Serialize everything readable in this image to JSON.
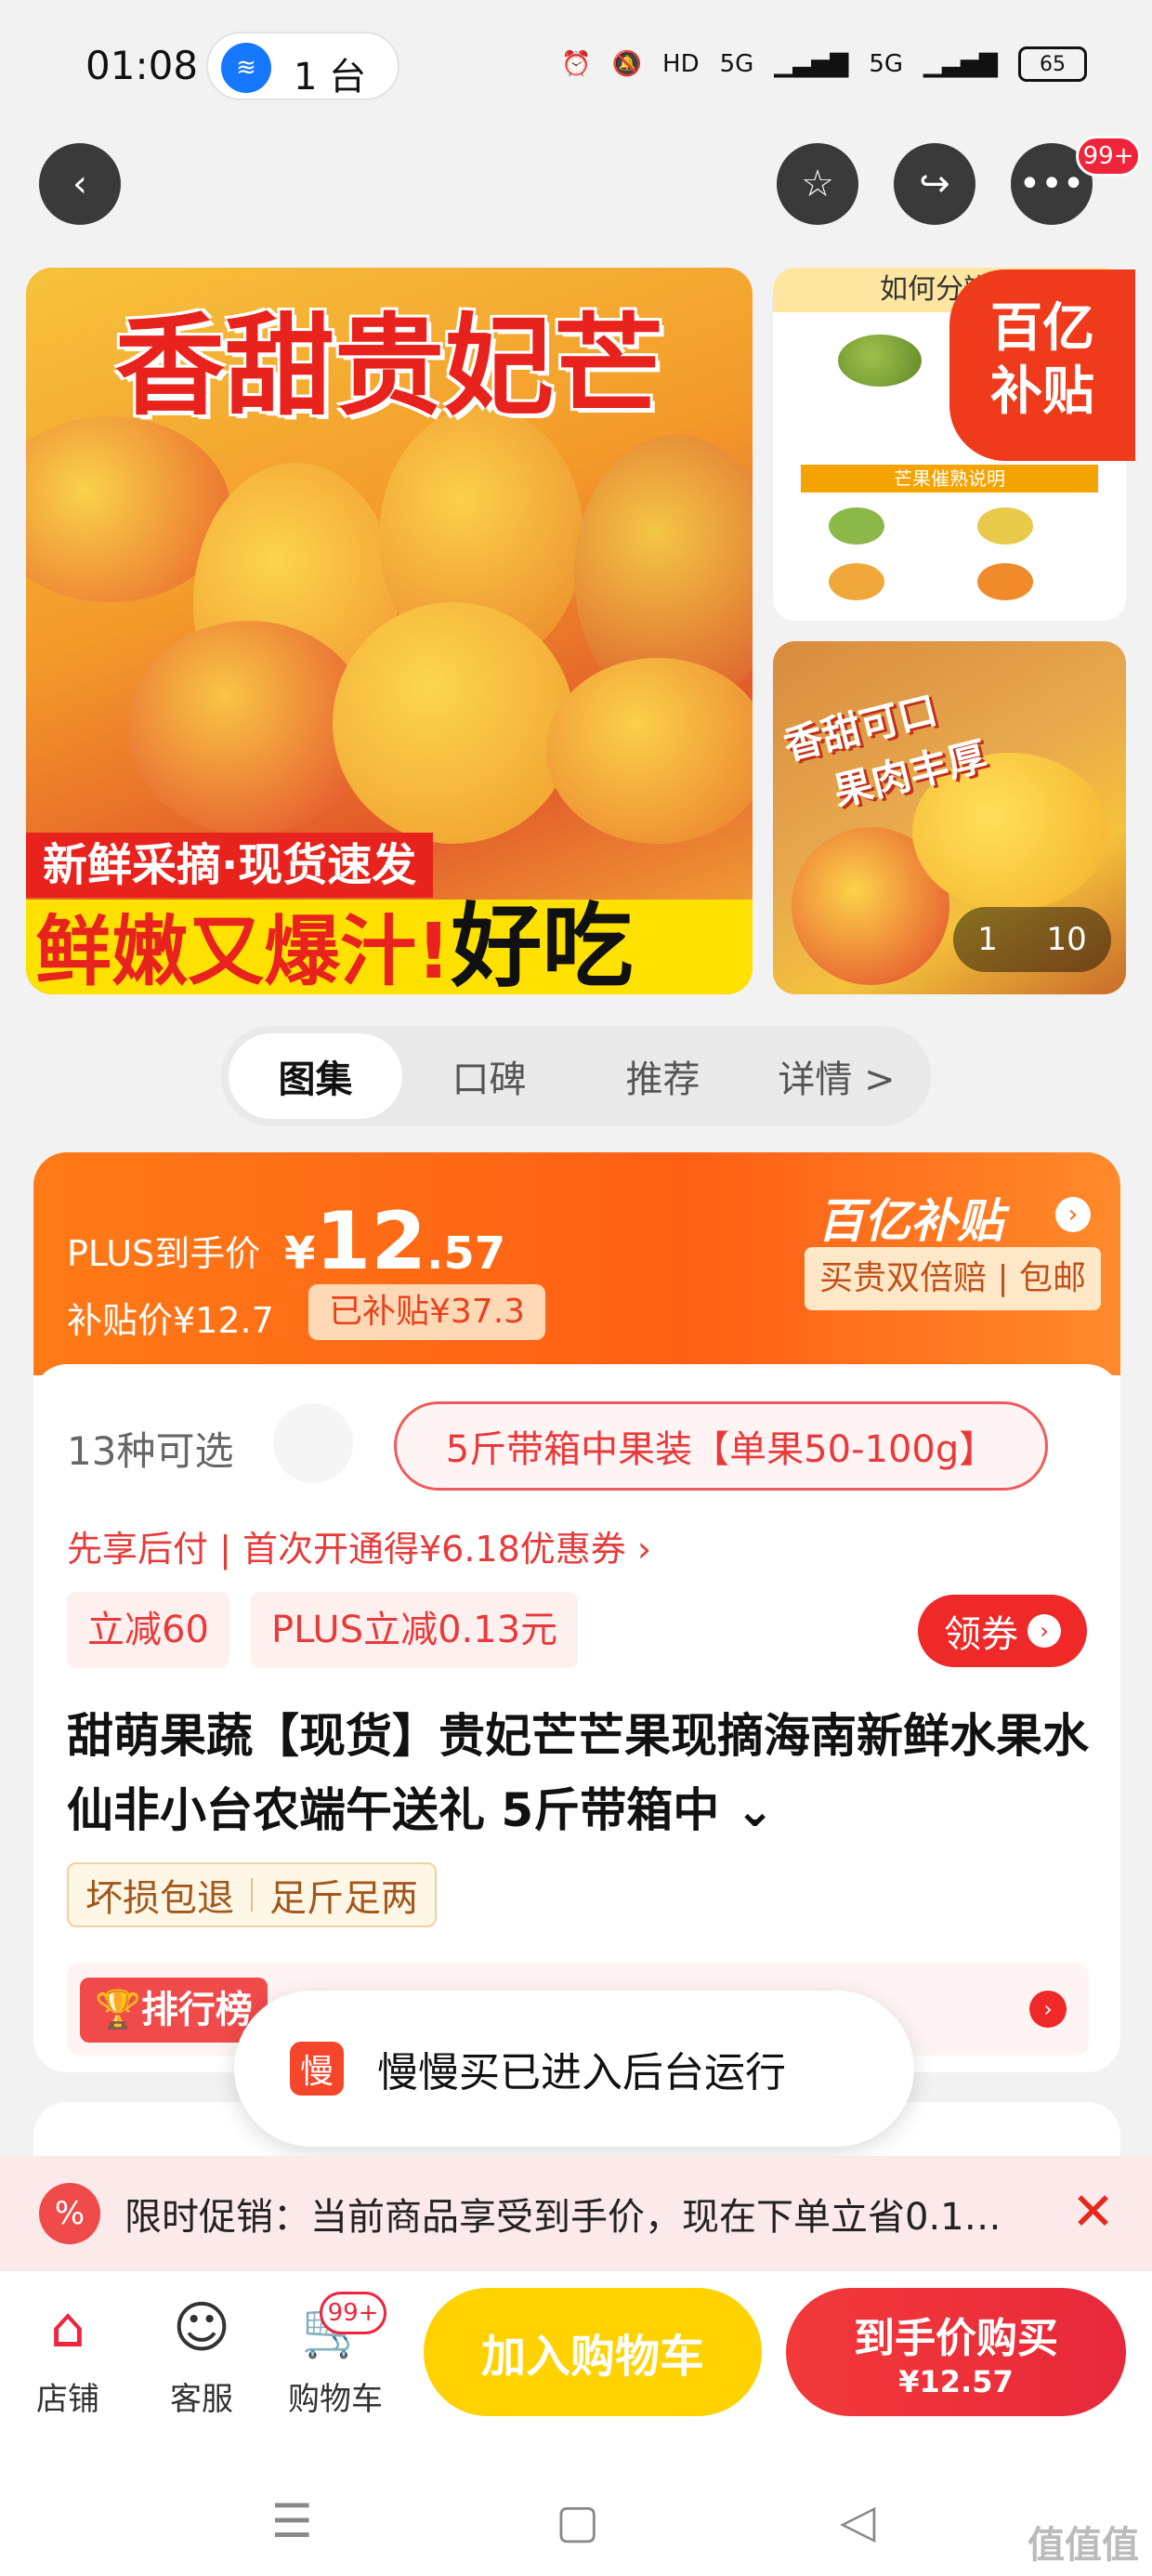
{
  "status_bar": {
    "time": "01:08",
    "hotspot_label": "1 台",
    "battery": "65",
    "signal_labels": [
      "HD",
      "5G",
      "5G"
    ]
  },
  "top_nav": {
    "more_badge": "99+"
  },
  "gallery": {
    "main_title": "香甜贵妃芒",
    "band1": "新鲜采摘·现货速发",
    "band2_red": "鲜嫩又爆汁!",
    "band2_black": "好吃",
    "side1_head": "如何分辨生",
    "side1_bar": "芒果催熟说明",
    "subsidy_tag_1": "百亿",
    "subsidy_tag_2": "补贴",
    "side2_text_1": "香甜可口",
    "side2_text_2": "果肉丰厚",
    "counter_current": "1",
    "counter_total": "10"
  },
  "tabs": [
    {
      "label": "图集"
    },
    {
      "label": "口碑"
    },
    {
      "label": "推荐"
    },
    {
      "label": "详情 >"
    }
  ],
  "price": {
    "plus_label": "PLUS到手价",
    "currency": "¥",
    "int_part": "12",
    "dec_part": ".57",
    "subsidy_label": "补贴价¥12.7",
    "subsidy_chip": "已补贴¥37.3",
    "brand": "百亿补贴",
    "guarantee": "买贵双倍赔 | 包邮"
  },
  "options": {
    "count_label": "13种可选",
    "selected": "5斤带箱中果装【单果50-100g】"
  },
  "pay_line": "先享后付 | 首次开通得¥6.18优惠券 ›",
  "coupons": [
    "立减60",
    "PLUS立减0.13元"
  ],
  "coupon_button": "领券",
  "product_title": "甜萌果蔬【现货】贵妃芒芒果现摘海南新鲜水果水仙非小台农端午送礼 5斤带箱中 ⌄",
  "features": [
    "坏损包退",
    "足斤足两"
  ],
  "rank_tag": "排行榜",
  "toast": {
    "icon": "慢",
    "text": "慢慢买已进入后台运行"
  },
  "promo": {
    "icon": "%",
    "text": "限时促销：当前商品享受到手价，现在下单立省0.1…",
    "close": "✕"
  },
  "bottom_bar": {
    "shop": "店铺",
    "service": "客服",
    "cart": "购物车",
    "cart_badge": "99+",
    "add_to_cart": "加入购物车",
    "buy_line1": "到手价购买",
    "buy_line2": "¥12.57"
  },
  "watermark": "值值值",
  "colors": {
    "accent_orange": "#ff6414",
    "accent_red": "#ef2828",
    "cart_yellow": "#ffd200"
  }
}
